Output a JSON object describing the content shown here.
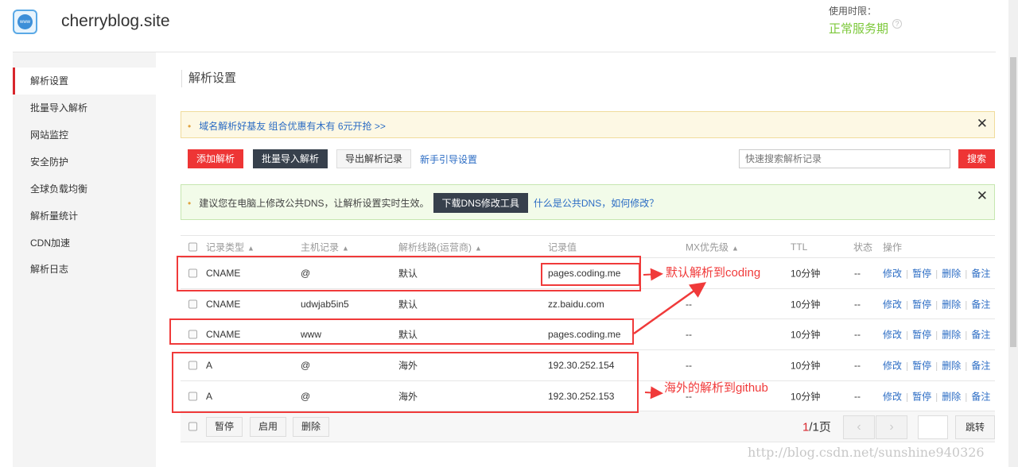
{
  "header": {
    "domain": "cherryblog.site",
    "logo_text": "www",
    "usage_label": "使用时限：",
    "service_status": "正常服务期",
    "help_icon": "?"
  },
  "sidebar": {
    "items": [
      {
        "label": "解析设置",
        "active": true
      },
      {
        "label": "批量导入解析"
      },
      {
        "label": "网站监控"
      },
      {
        "label": "安全防护"
      },
      {
        "label": "全球负载均衡"
      },
      {
        "label": "解析量统计"
      },
      {
        "label": "CDN加速"
      },
      {
        "label": "解析日志"
      }
    ]
  },
  "main": {
    "title": "解析设置",
    "promo": "域名解析好基友 组合优惠有木有 6元开抢 >>",
    "close": "✕",
    "toolbar": {
      "add": "添加解析",
      "batch_import": "批量导入解析",
      "export": "导出解析记录",
      "guide": "新手引导设置",
      "search_placeholder": "快速搜索解析记录",
      "search_btn": "搜索"
    },
    "dns_notice": {
      "text": "建议您在电脑上修改公共DNS，让解析设置实时生效。",
      "download": "下载DNS修改工具",
      "link": "什么是公共DNS，如何修改？"
    },
    "table": {
      "headers": {
        "type": "记录类型",
        "host": "主机记录",
        "line": "解析线路(运营商)",
        "value": "记录值",
        "mx": "MX优先级",
        "ttl": "TTL",
        "status": "状态",
        "ops": "操作"
      },
      "rows": [
        {
          "type": "CNAME",
          "host": "@",
          "line": "默认",
          "value": "pages.coding.me",
          "mx": "",
          "ttl": "10分钟",
          "status": "--"
        },
        {
          "type": "CNAME",
          "host": "udwjab5in5",
          "line": "默认",
          "value": "zz.baidu.com",
          "mx": "--",
          "ttl": "10分钟",
          "status": "--"
        },
        {
          "type": "CNAME",
          "host": "www",
          "line": "默认",
          "value": "pages.coding.me",
          "mx": "--",
          "ttl": "10分钟",
          "status": "--"
        },
        {
          "type": "A",
          "host": "@",
          "line": "海外",
          "value": "192.30.252.154",
          "mx": "--",
          "ttl": "10分钟",
          "status": "--"
        },
        {
          "type": "A",
          "host": "@",
          "line": "海外",
          "value": "192.30.252.153",
          "mx": "--",
          "ttl": "10分钟",
          "status": "--"
        }
      ],
      "row_ops": [
        "修改",
        "暂停",
        "删除",
        "备注"
      ],
      "footer": {
        "pause": "暂停",
        "enable": "启用",
        "delete": "删除",
        "page_current": "1",
        "page_total": "/1页",
        "jump": "跳转",
        "prev": "‹",
        "next": "›"
      }
    }
  },
  "annotations": {
    "coding": "默认解析到coding",
    "github": "海外的解析到github"
  },
  "watermark": "http://blog.csdn.net/sunshine940326"
}
